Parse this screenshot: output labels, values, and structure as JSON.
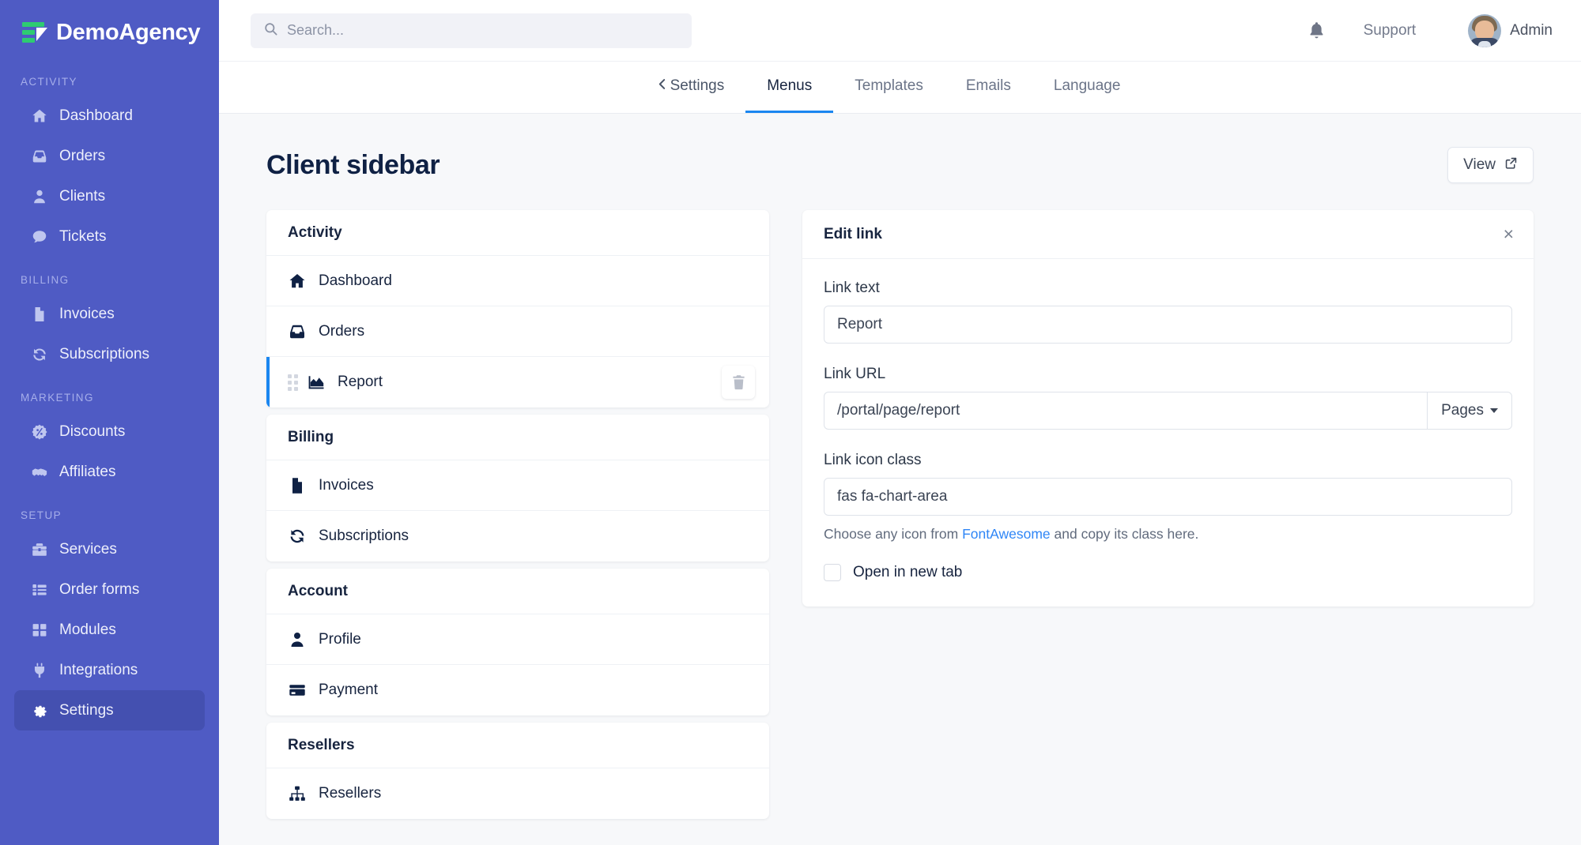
{
  "brand": {
    "name": "DemoAgency",
    "sidebar_color": "#4f5bc4",
    "logo_accent": "#2ecc71"
  },
  "sidebar": {
    "sections": [
      {
        "label": "ACTIVITY",
        "items": [
          {
            "label": "Dashboard",
            "icon": "home-icon",
            "active": false
          },
          {
            "label": "Orders",
            "icon": "inbox-icon",
            "active": false
          },
          {
            "label": "Clients",
            "icon": "user-icon",
            "active": false
          },
          {
            "label": "Tickets",
            "icon": "comment-icon",
            "active": false
          }
        ]
      },
      {
        "label": "BILLING",
        "items": [
          {
            "label": "Invoices",
            "icon": "file-invoice-icon",
            "active": false
          },
          {
            "label": "Subscriptions",
            "icon": "sync-icon",
            "active": false
          }
        ]
      },
      {
        "label": "MARKETING",
        "items": [
          {
            "label": "Discounts",
            "icon": "percent-badge-icon",
            "active": false
          },
          {
            "label": "Affiliates",
            "icon": "handshake-icon",
            "active": false
          }
        ]
      },
      {
        "label": "SETUP",
        "items": [
          {
            "label": "Services",
            "icon": "toolbox-icon",
            "active": false
          },
          {
            "label": "Order forms",
            "icon": "list-icon",
            "active": false
          },
          {
            "label": "Modules",
            "icon": "grid-icon",
            "active": false
          },
          {
            "label": "Integrations",
            "icon": "plug-icon",
            "active": false
          },
          {
            "label": "Settings",
            "icon": "gear-icon",
            "active": true
          }
        ]
      }
    ]
  },
  "topbar": {
    "search_placeholder": "Search...",
    "support_label": "Support",
    "user_name": "Admin"
  },
  "tabs": {
    "back_label": "Settings",
    "items": [
      {
        "label": "Menus",
        "active": true
      },
      {
        "label": "Templates",
        "active": false
      },
      {
        "label": "Emails",
        "active": false
      },
      {
        "label": "Language",
        "active": false
      }
    ]
  },
  "page": {
    "title": "Client sidebar",
    "view_button": "View"
  },
  "menu_groups": [
    {
      "heading": "Activity",
      "rows": [
        {
          "label": "Dashboard",
          "icon": "home-icon",
          "selected": false
        },
        {
          "label": "Orders",
          "icon": "inbox-icon",
          "selected": false
        },
        {
          "label": "Report",
          "icon": "chart-area-icon",
          "selected": true
        }
      ]
    },
    {
      "heading": "Billing",
      "rows": [
        {
          "label": "Invoices",
          "icon": "file-invoice-icon",
          "selected": false
        },
        {
          "label": "Subscriptions",
          "icon": "sync-icon",
          "selected": false
        }
      ]
    },
    {
      "heading": "Account",
      "rows": [
        {
          "label": "Profile",
          "icon": "user-icon",
          "selected": false
        },
        {
          "label": "Payment",
          "icon": "credit-card-icon",
          "selected": false
        }
      ]
    },
    {
      "heading": "Resellers",
      "rows": [
        {
          "label": "Resellers",
          "icon": "sitemap-icon",
          "selected": false
        }
      ]
    }
  ],
  "edit_panel": {
    "title": "Edit link",
    "close_label": "×",
    "link_text_label": "Link text",
    "link_text_value": "Report",
    "link_url_label": "Link URL",
    "link_url_value": "/portal/page/report",
    "pages_button": "Pages",
    "icon_class_label": "Link icon class",
    "icon_class_value": "fas fa-chart-area",
    "help_prefix": "Choose any icon from ",
    "help_link": "FontAwesome",
    "help_suffix": " and copy its class here.",
    "new_tab_label": "Open in new tab",
    "new_tab_checked": false
  },
  "colors": {
    "accent_blue": "#1a86f0",
    "link_blue": "#2f86f6",
    "title_navy": "#0f2144"
  }
}
